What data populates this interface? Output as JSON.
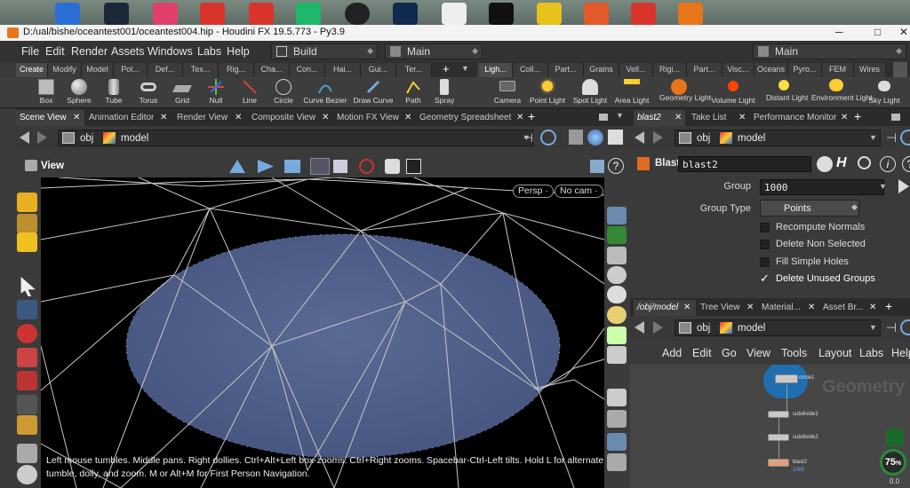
{
  "window": {
    "title": "D:/ual/bishe/oceantest001/oceantest004.hip - Houdini FX 19.5.773 - Py3.9"
  },
  "menubar": {
    "items": [
      "File",
      "Edit",
      "Render",
      "Assets",
      "Windows",
      "Labs",
      "Help"
    ],
    "desktop_label": "Build",
    "context_label": "Main",
    "right_context_label": "Main"
  },
  "shelf_left": {
    "tabs": [
      "Create",
      "Modify",
      "Model",
      "Pol...",
      "Def...",
      "Tex...",
      "Rig...",
      "Cha...",
      "Con...",
      "Hai...",
      "Gui...",
      "Ter..."
    ],
    "tools": [
      "Box",
      "Sphere",
      "Tube",
      "Torus",
      "Grid",
      "Null",
      "Line",
      "Circle",
      "Curve Bezier",
      "Draw Curve",
      "Path",
      "Spray"
    ]
  },
  "shelf_right": {
    "tabs": [
      "Ligh...",
      "Coll...",
      "Part...",
      "Grains",
      "Vell...",
      "Rigi...",
      "Part...",
      "Visc...",
      "Oceans",
      "Pyro...",
      "FEM",
      "Wires"
    ],
    "tools": [
      "Camera",
      "Point Light",
      "Spot Light",
      "Area Light",
      "Geometry Light",
      "Volume Light",
      "Distant Light",
      "Environment Light",
      "Sky Light"
    ]
  },
  "left_pane": {
    "tabs": [
      "Scene View",
      "Animation Editor",
      "Render View",
      "Composite View",
      "Motion FX View",
      "Geometry Spreadsheet"
    ],
    "path": {
      "obj": "obj",
      "node": "model"
    },
    "view_label": "View",
    "badges": {
      "persp": "Persp",
      "cam": "No cam"
    },
    "status": "Left mouse tumbles. Middle pans. Right dollies. Ctrl+Alt+Left box-zooms. Ctrl+Right zooms. Spacebar-Ctrl-Left tilts. Hold L for alternate tumble, dolly, and zoom.    M or Alt+M for First Person Navigation."
  },
  "parm_pane": {
    "tabs": [
      "blast2",
      "Take List",
      "Performance Monitor"
    ],
    "path": {
      "obj": "obj",
      "node": "model"
    },
    "node_type": "Blast",
    "node_name": "blast2",
    "group_label": "Group",
    "group_value": "1000",
    "group_type_label": "Group Type",
    "group_type_value": "Points",
    "checkboxes": [
      {
        "label": "Recompute Normals",
        "checked": false
      },
      {
        "label": "Delete Non Selected",
        "checked": false
      },
      {
        "label": "Fill Simple Holes",
        "checked": false
      },
      {
        "label": "Delete Unused Groups",
        "checked": true
      }
    ]
  },
  "network_pane": {
    "tabs": [
      "/obj/model",
      "Tree View",
      "Material...",
      "Asset Br..."
    ],
    "path": {
      "obj": "obj",
      "node": "model"
    },
    "menu": [
      "Add",
      "Edit",
      "Go",
      "View",
      "Tools",
      "Layout",
      "Labs",
      "Help"
    ],
    "watermark": "Geometry",
    "nodes": [
      {
        "name": "circle1",
        "sub": ""
      },
      {
        "name": "subdivide1",
        "sub": ""
      },
      {
        "name": "subdivide2",
        "sub": ""
      },
      {
        "name": "blast2",
        "sub": "1000"
      }
    ],
    "perf_value": "75",
    "perf_unit": "%",
    "perf_small": "0.0"
  },
  "colors": {
    "accent": "#e8751a",
    "sphere_blue": "#4a5a86",
    "panel": "#3a3a3a"
  }
}
